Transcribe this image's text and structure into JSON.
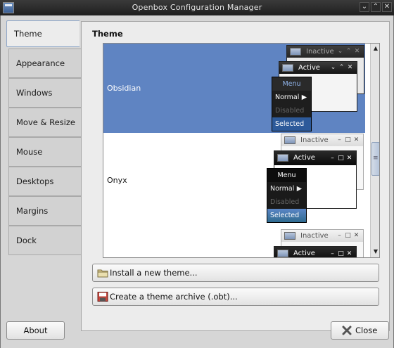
{
  "window": {
    "title": "Openbox Configuration Manager"
  },
  "titlebar_buttons": [
    "⌄",
    "⌃",
    "✕"
  ],
  "tabs": [
    {
      "label": "Theme"
    },
    {
      "label": "Appearance"
    },
    {
      "label": "Windows"
    },
    {
      "label": "Move & Resize"
    },
    {
      "label": "Mouse"
    },
    {
      "label": "Desktops"
    },
    {
      "label": "Margins"
    },
    {
      "label": "Dock"
    }
  ],
  "panel": {
    "title": "Theme"
  },
  "themes": [
    {
      "name": "Obsidian",
      "selected": true
    },
    {
      "name": "Onyx",
      "selected": false
    }
  ],
  "preview": {
    "inactive": "Inactive",
    "active": "Active",
    "menu_title": "Menu",
    "menu_normal": "Normal",
    "menu_disabled": "Disabled",
    "menu_selected": "Selected"
  },
  "buttons": {
    "install": "Install a new theme...",
    "archive": "Create a theme archive (.obt)...",
    "about": "About",
    "close": "Close"
  },
  "colors": {
    "selection": "#5f84c2"
  }
}
